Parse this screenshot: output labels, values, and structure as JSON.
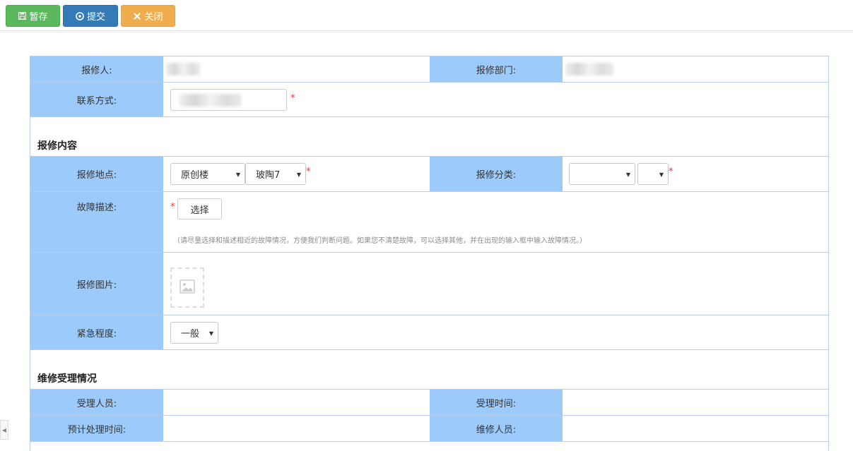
{
  "toolbar": {
    "save_label": "暂存",
    "submit_label": "提交",
    "close_label": "关闭"
  },
  "applicant": {
    "reporter_label": "报修人:",
    "department_label": "报修部门:",
    "contact_label": "联系方式:",
    "required_mark": "*"
  },
  "content_section": {
    "title": "报修内容",
    "location_label": "报修地点:",
    "building_value": "原创楼",
    "room_value": "玻陶7",
    "category_label": "报修分类:",
    "category_value": "",
    "subcategory_value": "",
    "fault_label": "故障描述:",
    "choose_button": "选择",
    "fault_hint": "（请尽量选择和描述相近的故障情况，方便我们判断问题。如果您不清楚故障，可以选择其他，并在出现的输入框中输入故障情况。）",
    "image_label": "报修图片:",
    "urgency_label": "紧急程度:",
    "urgency_value": "一般"
  },
  "handling_section": {
    "title": "维修受理情况",
    "receiver_label": "受理人员:",
    "receive_time_label": "受理时间:",
    "eta_label": "预计处理时间:",
    "repairer_label": "维修人员:"
  },
  "colors": {
    "label_bg": "#9ccbfb",
    "border": "#b7cde8",
    "save": "#5cb85c",
    "submit": "#337ab7",
    "close": "#f0ad4e",
    "required": "#e4393c"
  }
}
